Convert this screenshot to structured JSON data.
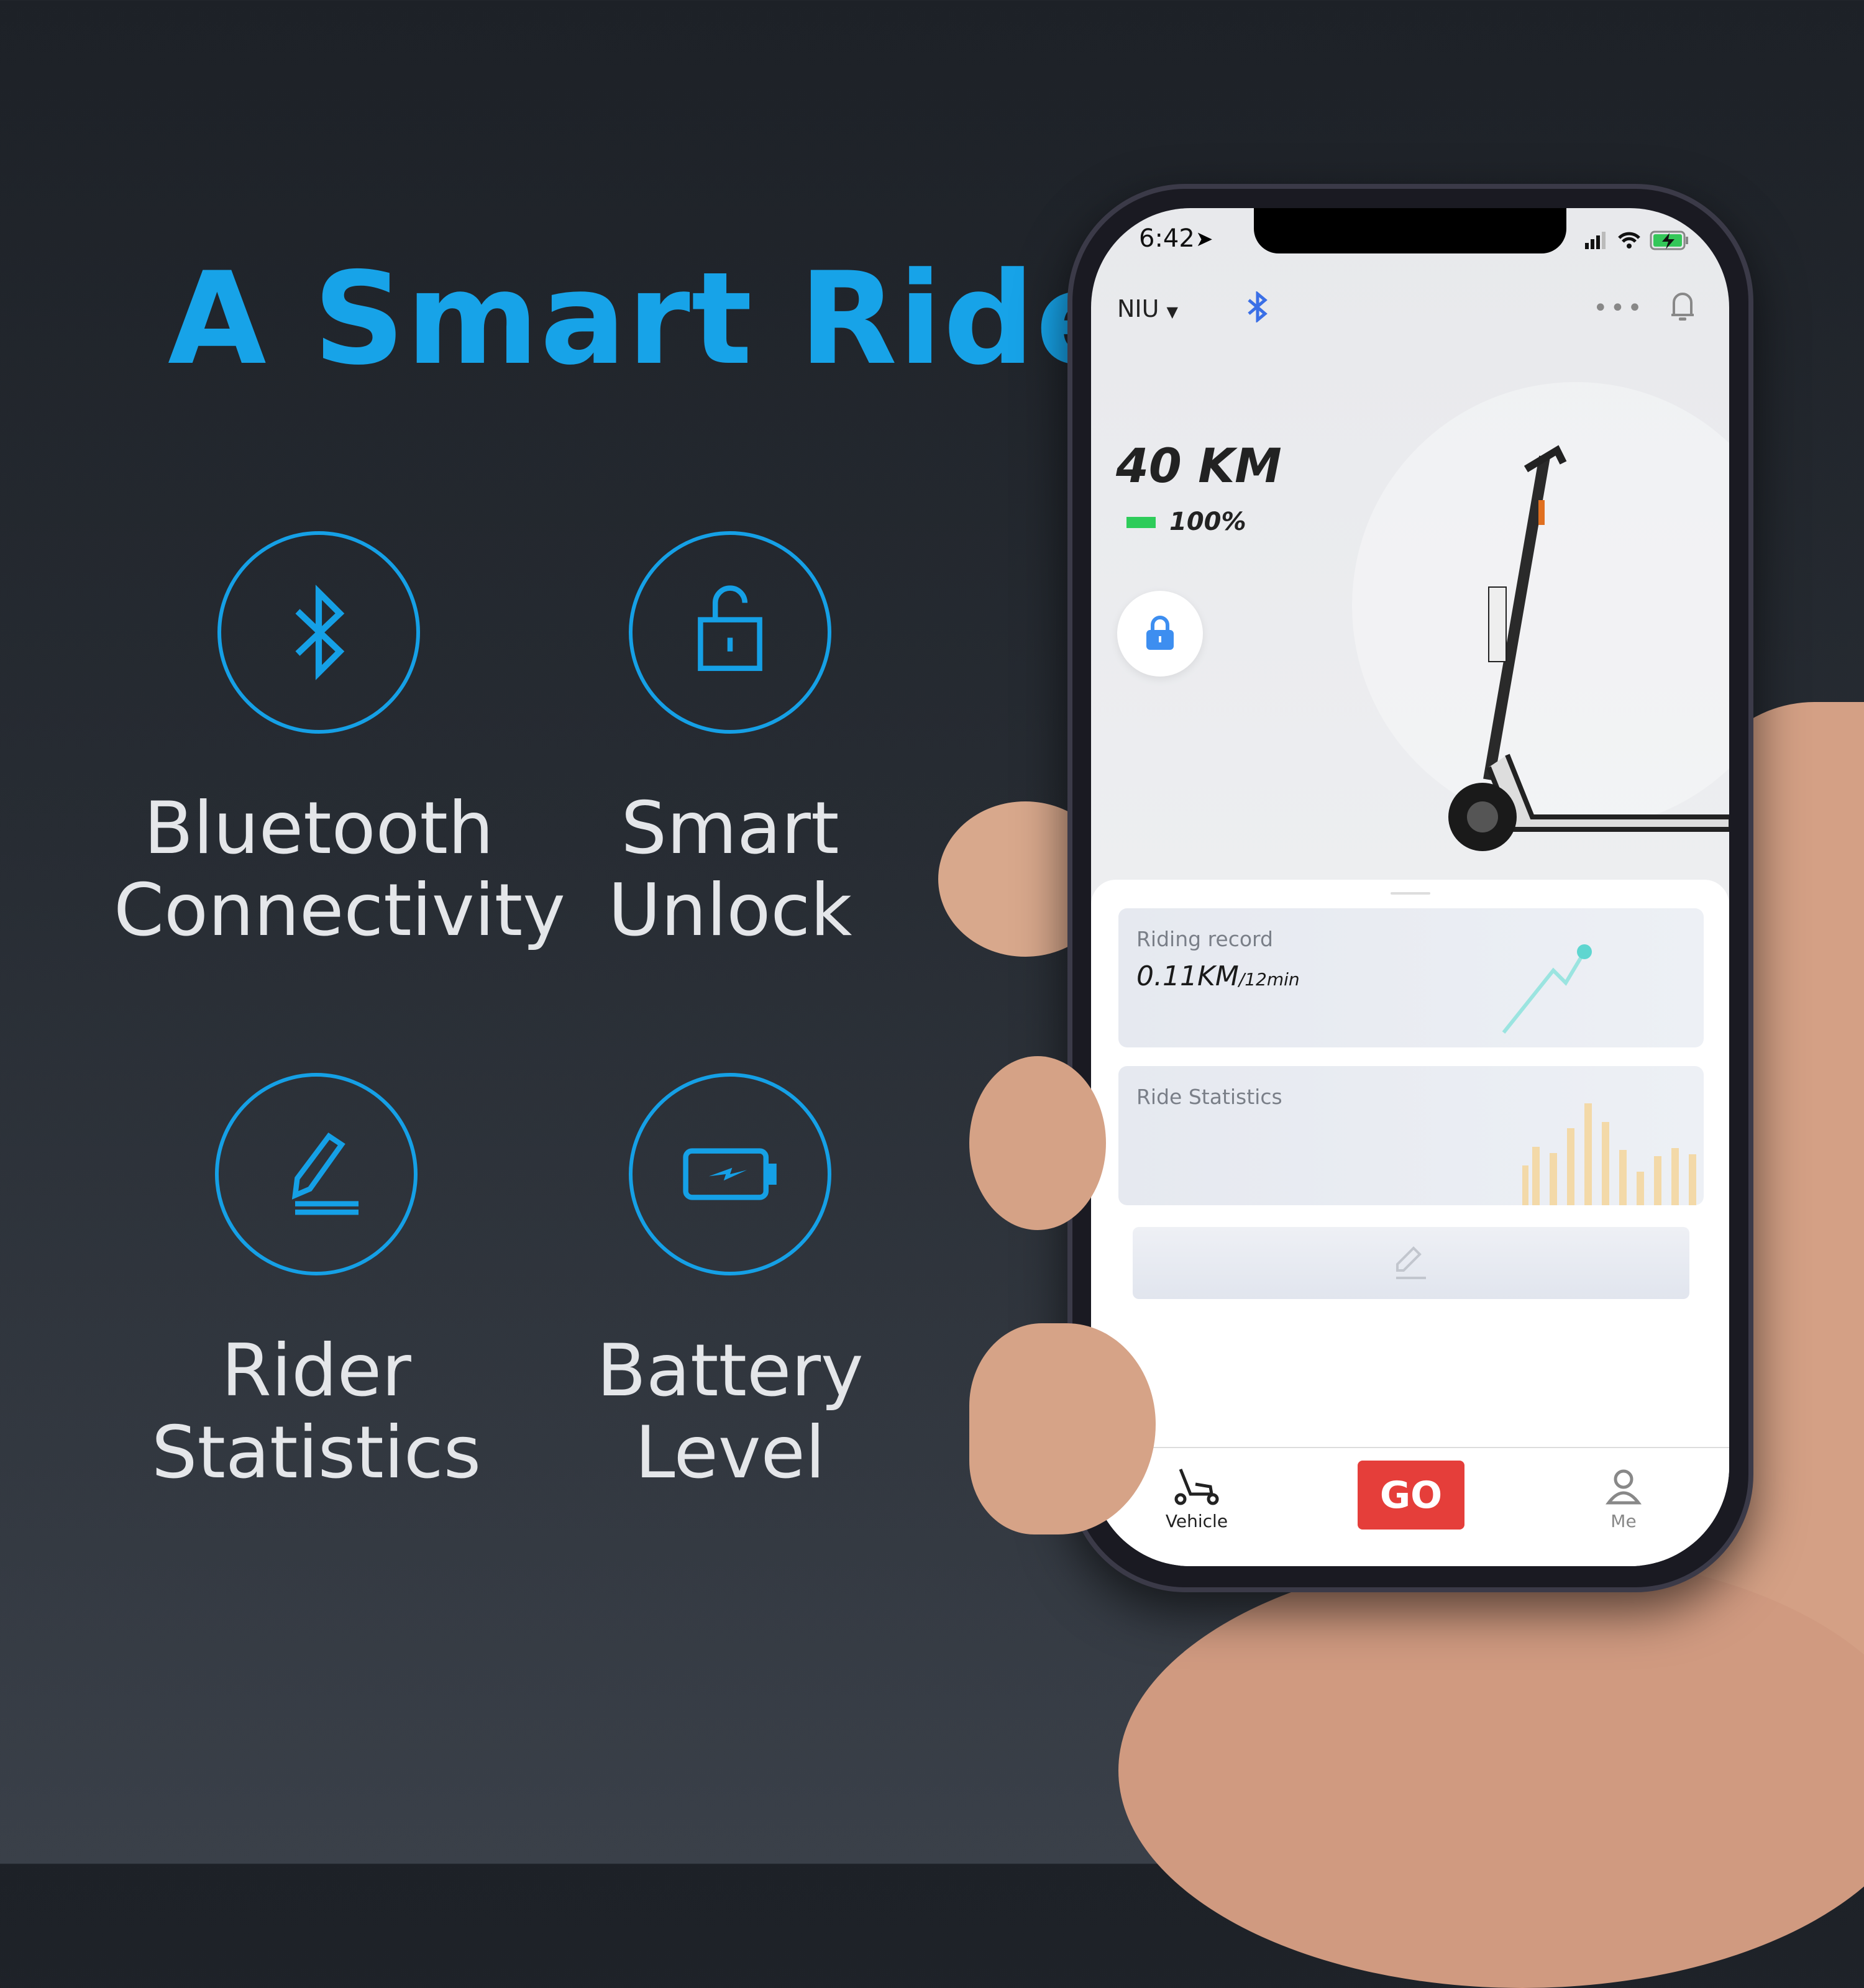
{
  "headline": "A Smart Ride",
  "features": [
    {
      "icon": "bluetooth-icon",
      "line1": "Bluetooth",
      "line2": "Connectivity"
    },
    {
      "icon": "unlock-icon",
      "line1": "Smart",
      "line2": "Unlock"
    },
    {
      "icon": "pencil-icon",
      "line1": "Rider",
      "line2": "Statistics"
    },
    {
      "icon": "battery-charging-icon",
      "line1": "Battery",
      "line2": "Level"
    }
  ],
  "accent": "#17a3e8",
  "phone": {
    "status": {
      "time": "6:42"
    },
    "header": {
      "vehicle": "NIU",
      "bluetooth_color": "#3a6fe6"
    },
    "range": "40 KM",
    "battery_percent": "100%",
    "battery_level": 1.0,
    "riding_record": {
      "label": "Riding record",
      "distance": "0.11KM",
      "duration": "/12min"
    },
    "ride_statistics": {
      "label": "Ride Statistics"
    },
    "tabs": {
      "vehicle": "Vehicle",
      "go": "GO",
      "me": "Me"
    },
    "go_color": "#e53e3a"
  }
}
